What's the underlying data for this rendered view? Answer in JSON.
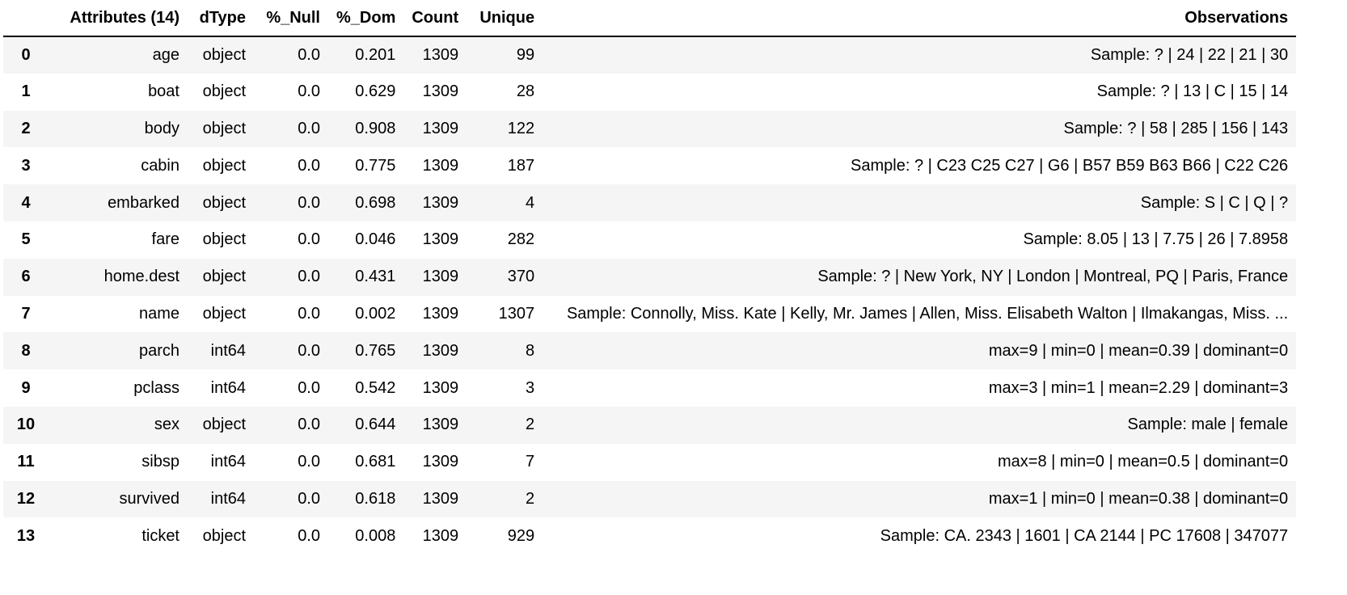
{
  "table": {
    "columns": {
      "index": "",
      "attributes": "Attributes (14)",
      "dtype": "dType",
      "null": "%_Null",
      "dom": "%_Dom",
      "count": "Count",
      "unique": "Unique",
      "observations": "Observations"
    },
    "rows": [
      {
        "index": "0",
        "attr": "age",
        "dtype": "object",
        "null": "0.0",
        "dom": "0.201",
        "count": "1309",
        "unique": "99",
        "obs": "Sample: ? | 24 | 22 | 21 | 30"
      },
      {
        "index": "1",
        "attr": "boat",
        "dtype": "object",
        "null": "0.0",
        "dom": "0.629",
        "count": "1309",
        "unique": "28",
        "obs": "Sample: ? | 13 | C | 15 | 14"
      },
      {
        "index": "2",
        "attr": "body",
        "dtype": "object",
        "null": "0.0",
        "dom": "0.908",
        "count": "1309",
        "unique": "122",
        "obs": "Sample: ? | 58 | 285 | 156 | 143"
      },
      {
        "index": "3",
        "attr": "cabin",
        "dtype": "object",
        "null": "0.0",
        "dom": "0.775",
        "count": "1309",
        "unique": "187",
        "obs": "Sample: ? | C23 C25 C27 | G6 | B57 B59 B63 B66 | C22 C26"
      },
      {
        "index": "4",
        "attr": "embarked",
        "dtype": "object",
        "null": "0.0",
        "dom": "0.698",
        "count": "1309",
        "unique": "4",
        "obs": "Sample: S | C | Q | ?"
      },
      {
        "index": "5",
        "attr": "fare",
        "dtype": "object",
        "null": "0.0",
        "dom": "0.046",
        "count": "1309",
        "unique": "282",
        "obs": "Sample: 8.05 | 13 | 7.75 | 26 | 7.8958"
      },
      {
        "index": "6",
        "attr": "home.dest",
        "dtype": "object",
        "null": "0.0",
        "dom": "0.431",
        "count": "1309",
        "unique": "370",
        "obs": "Sample: ? | New York, NY | London | Montreal, PQ | Paris, France"
      },
      {
        "index": "7",
        "attr": "name",
        "dtype": "object",
        "null": "0.0",
        "dom": "0.002",
        "count": "1309",
        "unique": "1307",
        "obs": "Sample: Connolly, Miss. Kate | Kelly, Mr. James | Allen, Miss. Elisabeth Walton | Ilmakangas, Miss. ..."
      },
      {
        "index": "8",
        "attr": "parch",
        "dtype": "int64",
        "null": "0.0",
        "dom": "0.765",
        "count": "1309",
        "unique": "8",
        "obs": "max=9 | min=0 | mean=0.39 | dominant=0"
      },
      {
        "index": "9",
        "attr": "pclass",
        "dtype": "int64",
        "null": "0.0",
        "dom": "0.542",
        "count": "1309",
        "unique": "3",
        "obs": "max=3 | min=1 | mean=2.29 | dominant=3"
      },
      {
        "index": "10",
        "attr": "sex",
        "dtype": "object",
        "null": "0.0",
        "dom": "0.644",
        "count": "1309",
        "unique": "2",
        "obs": "Sample: male | female"
      },
      {
        "index": "11",
        "attr": "sibsp",
        "dtype": "int64",
        "null": "0.0",
        "dom": "0.681",
        "count": "1309",
        "unique": "7",
        "obs": "max=8 | min=0 | mean=0.5 | dominant=0"
      },
      {
        "index": "12",
        "attr": "survived",
        "dtype": "int64",
        "null": "0.0",
        "dom": "0.618",
        "count": "1309",
        "unique": "2",
        "obs": "max=1 | min=0 | mean=0.38 | dominant=0"
      },
      {
        "index": "13",
        "attr": "ticket",
        "dtype": "object",
        "null": "0.0",
        "dom": "0.008",
        "count": "1309",
        "unique": "929",
        "obs": "Sample: CA. 2343 | 1601 | CA 2144 | PC 17608 | 347077"
      }
    ]
  }
}
